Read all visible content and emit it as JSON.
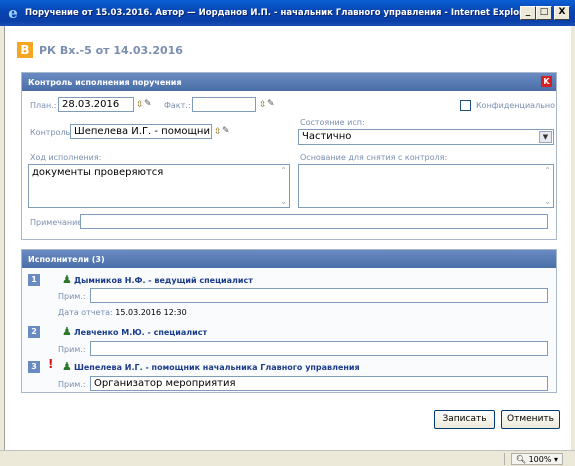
{
  "window": {
    "title": "Поручение от 15.03.2016. Автор — Иорданов И.П. - начальник Главного управления - Internet Explorer",
    "minimize": "_",
    "maximize": "□",
    "close": "X"
  },
  "header": {
    "badge": "B",
    "title": "РК Вх.-5 от 14.03.2016"
  },
  "control_panel": {
    "title": "Контроль исполнения поручения",
    "close_label": "K",
    "plan_label": "План.:",
    "plan_value": "28.03.2016",
    "fact_label": "Факт.:",
    "fact_value": "",
    "confidential_label": "Конфиденциально",
    "confidential_checked": false,
    "control_label": "Контроль:",
    "control_value": "Шепелева И.Г. - помощни",
    "state_label": "Состояние исп:",
    "state_value": "Частично",
    "progress_label": "Ход исполнения:",
    "progress_value": "документы проверяются",
    "removal_label": "Основание для снятия с контроля:",
    "removal_value": "",
    "note_label": "Примечание:",
    "note_value": ""
  },
  "executors_panel": {
    "title": "Исполнители (3)",
    "prim_label": "Прим.:",
    "report_date_label": "Дата отчета:",
    "items": [
      {
        "num": "1",
        "name": "Дымников Н.Ф. - ведущий специалист",
        "prim": "",
        "report_date": "15.03.2016 12:30",
        "important": false
      },
      {
        "num": "2",
        "name": "Левченко М.Ю. - специалист",
        "prim": "",
        "report_date": "",
        "important": false
      },
      {
        "num": "3",
        "name": "Шепелева И.Г. - помощник начальника Главного управления",
        "prim": "Организатор мероприятия",
        "report_date": "",
        "important": true
      }
    ]
  },
  "buttons": {
    "save": "Записать",
    "cancel": "Отменить"
  },
  "status": {
    "zoom": "100%"
  }
}
